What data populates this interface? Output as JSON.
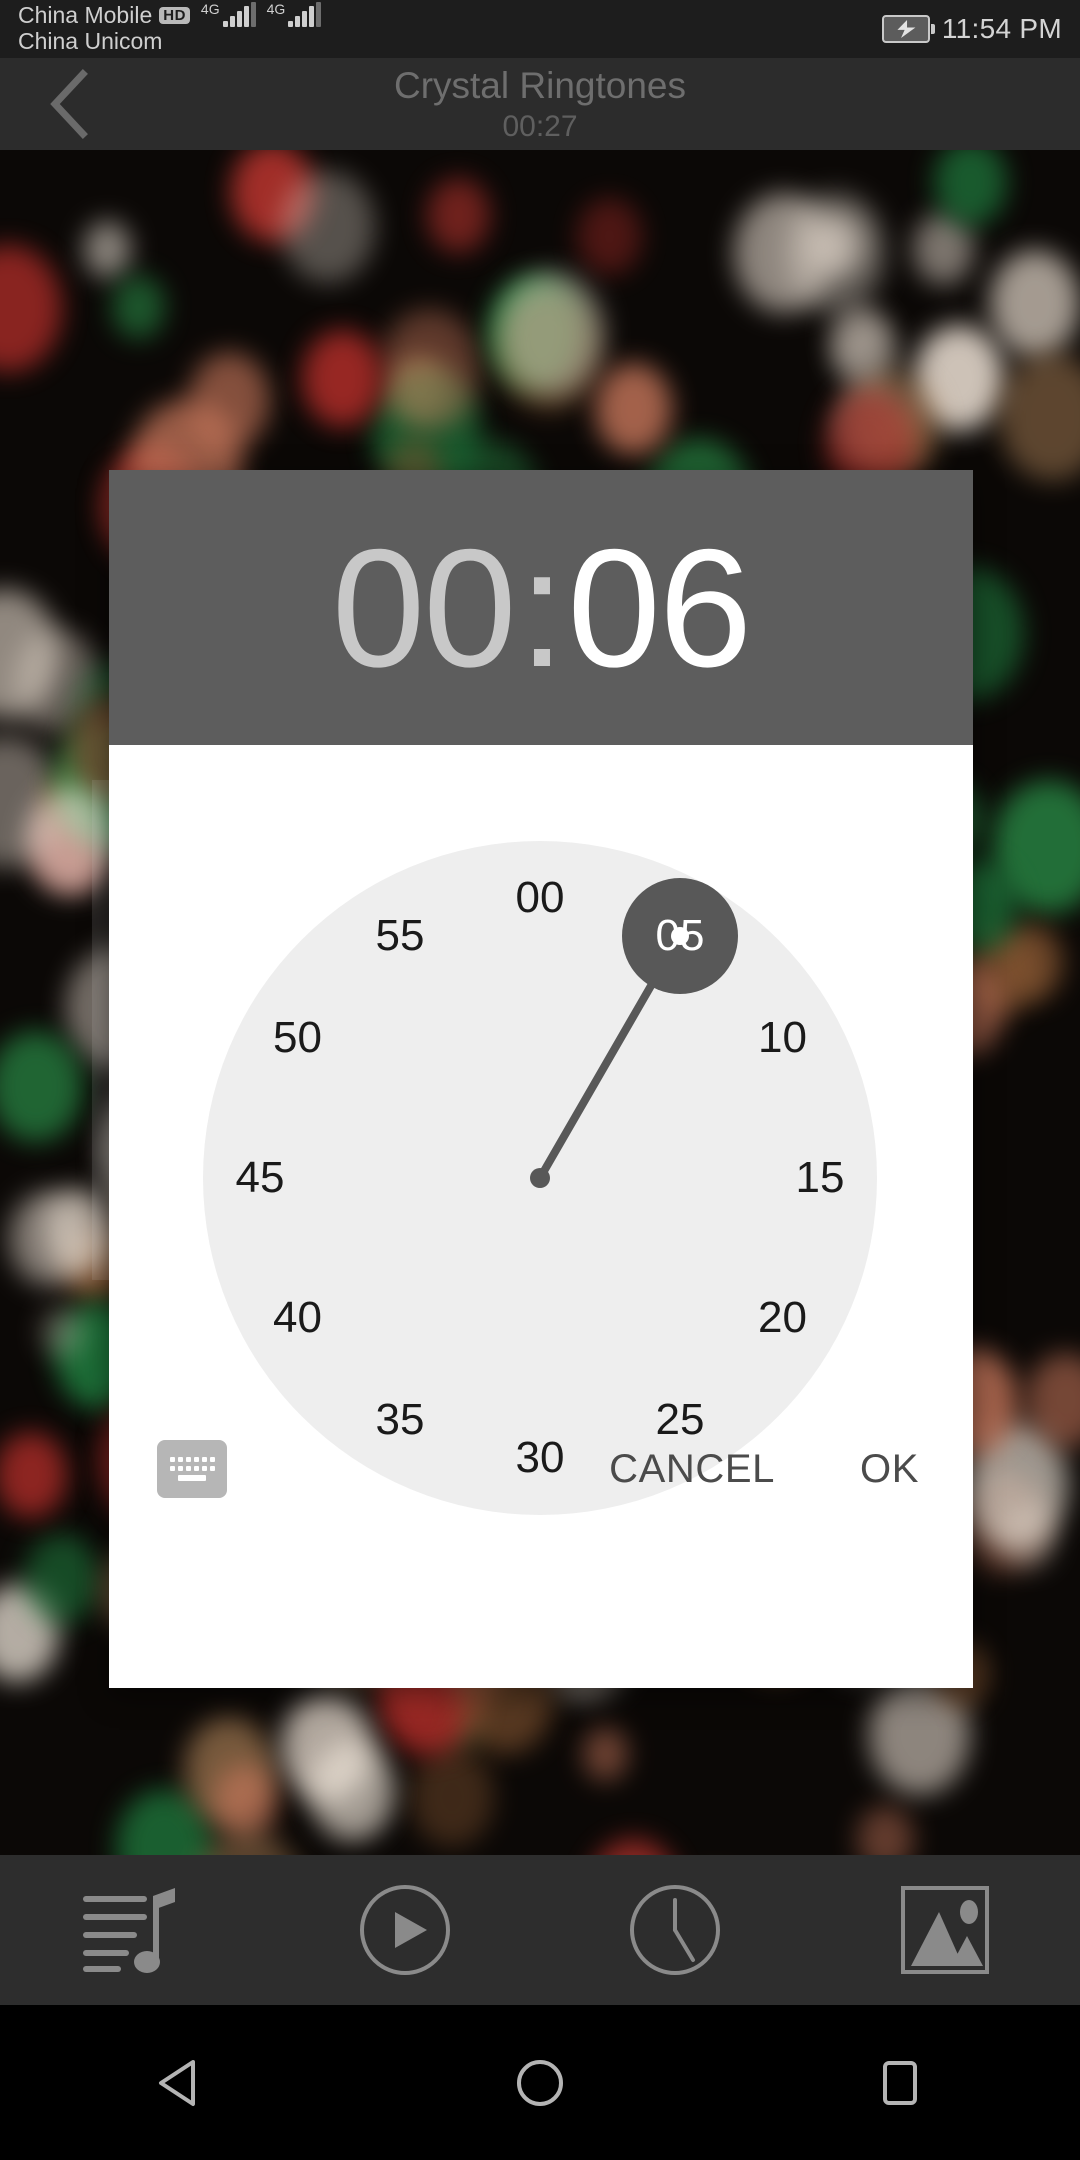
{
  "status_bar": {
    "carrier_primary": "China Mobile",
    "carrier_badge": "HD",
    "carrier_secondary": "China Unicom",
    "network_1": "4G",
    "network_2": "4G",
    "battery_icon": "battery-charging-icon",
    "time": "11:54 PM"
  },
  "title_bar": {
    "back_icon": "back-chevron-icon",
    "title": "Crystal Ringtones",
    "subtitle": "00:27"
  },
  "dialog": {
    "name": "time-picker-dialog",
    "header": {
      "hours": "00",
      "separator": ":",
      "minutes": "06",
      "selected_field": "minutes"
    },
    "clock": {
      "mode": "minutes",
      "selected_value": "05",
      "selected_angle_deg": 30,
      "tick_labels": [
        "00",
        "05",
        "10",
        "15",
        "20",
        "25",
        "30",
        "35",
        "40",
        "45",
        "50",
        "55"
      ],
      "face_color": "#eeeeee",
      "hand_color": "#585858",
      "selector_color": "#585858"
    },
    "actions": {
      "keyboard_icon": "keyboard-icon",
      "cancel_label": "CANCEL",
      "ok_label": "OK"
    }
  },
  "bottom_toolbar": {
    "items": [
      {
        "icon": "playlist-music-icon",
        "name": "toolbar-playlist"
      },
      {
        "icon": "play-circle-icon",
        "name": "toolbar-play"
      },
      {
        "icon": "clock-icon",
        "name": "toolbar-timer"
      },
      {
        "icon": "image-icon",
        "name": "toolbar-image"
      }
    ]
  },
  "nav_bar": {
    "items": [
      {
        "icon": "back-triangle-icon",
        "name": "nav-back"
      },
      {
        "icon": "home-circle-icon",
        "name": "nav-home"
      },
      {
        "icon": "recents-square-icon",
        "name": "nav-recents"
      }
    ]
  },
  "colors": {
    "status_bar_bg": "#1d1d1d",
    "title_bar_bg": "#2c2c2c",
    "dialog_header_bg": "#5d5d5d",
    "dialog_bg": "#ffffff",
    "accent": "#585858"
  }
}
